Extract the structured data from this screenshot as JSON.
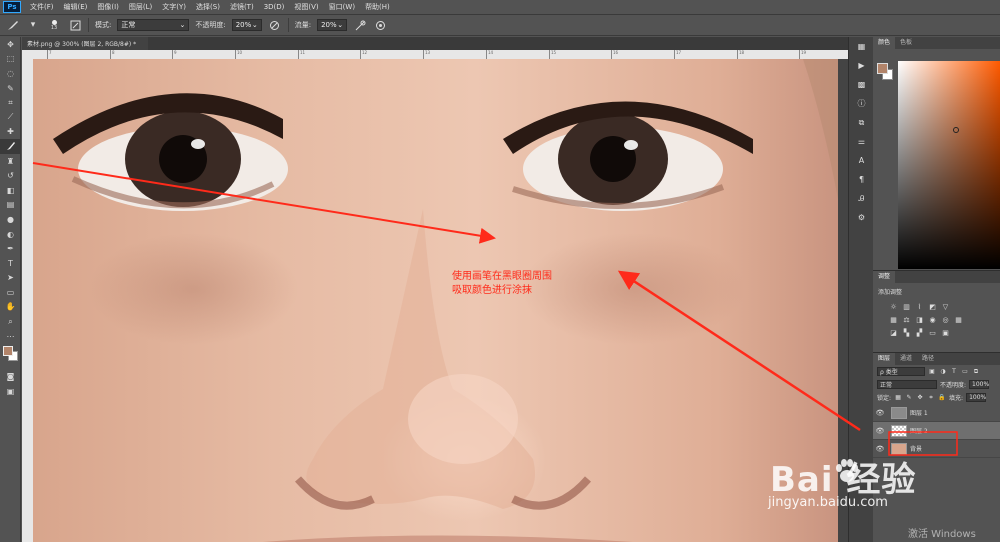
{
  "app": {
    "logo": "Ps",
    "menu": [
      "文件(F)",
      "编辑(E)",
      "图像(I)",
      "图层(L)",
      "文字(Y)",
      "选择(S)",
      "滤镜(T)",
      "3D(D)",
      "视图(V)",
      "窗口(W)",
      "帮助(H)"
    ]
  },
  "options": {
    "brush_size": "13",
    "mode_label": "模式:",
    "mode_value": "正常",
    "opacity_label": "不透明度:",
    "opacity_value": "20%",
    "flow_label": "流量:",
    "flow_value": "20%"
  },
  "document": {
    "tab_title": "素材.png @ 300% (图层 2, RGB/8#) *",
    "ruler_marks": [
      "7",
      "8",
      "9",
      "10",
      "11",
      "12",
      "13",
      "14",
      "15",
      "16",
      "17",
      "18",
      "19"
    ]
  },
  "annotation": {
    "line1": "使用画笔在黑眼圈周围",
    "line2": "吸取颜色进行涂抹",
    "color": "#ff2a1a"
  },
  "panels": {
    "color_tabs": [
      "颜色",
      "色板"
    ],
    "adjust_tab": "调整",
    "adjust_title": "添加调整",
    "layers_tabs": [
      "图层",
      "通道",
      "路径"
    ],
    "filter_type": "ρ 类型",
    "blend_mode": "正常",
    "opacity_label": "不透明度:",
    "opacity_value": "100%",
    "lock_label": "锁定:",
    "fill_label": "填充:",
    "fill_value": "100%",
    "layers": [
      {
        "name": "图层 1",
        "visible": true,
        "thumb": "gray"
      },
      {
        "name": "图层 2",
        "visible": true,
        "thumb": "transparent",
        "selected": true
      },
      {
        "name": "背景",
        "visible": true,
        "thumb": "photo"
      }
    ],
    "fg_color": "#b2846a",
    "bg_color": "#ffffff"
  },
  "watermark": {
    "brand": "Bai  经验",
    "url": "jingyan.baidu.com",
    "windows": "激活 Windows"
  },
  "icons": {
    "tools": [
      "move-icon",
      "marquee-icon",
      "lasso-icon",
      "quick-select-icon",
      "crop-icon",
      "eyedropper-icon",
      "brush-icon",
      "healing-icon",
      "stamp-icon",
      "history-brush-icon",
      "eraser-icon",
      "gradient-icon",
      "blur-icon",
      "dodge-icon",
      "pen-icon",
      "type-icon",
      "path-select-icon",
      "rectangle-icon",
      "hand-icon",
      "zoom-icon"
    ]
  }
}
